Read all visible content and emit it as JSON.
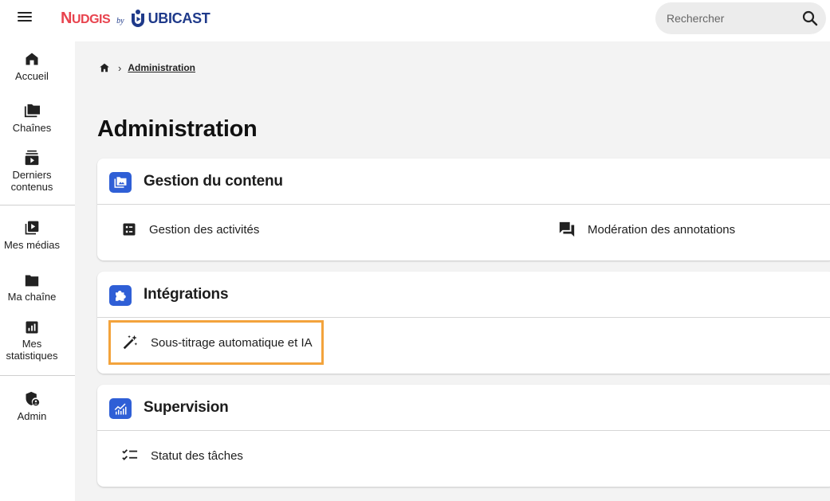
{
  "header": {
    "logo": {
      "brand_prefix": "N",
      "brand_rest": "UDGIS",
      "by": "by",
      "company": "UBICAST"
    },
    "search": {
      "placeholder": "Rechercher"
    }
  },
  "sidebar": {
    "items": [
      {
        "label": "Accueil",
        "icon": "home-icon"
      },
      {
        "label": "Chaînes",
        "icon": "folders-icon"
      },
      {
        "label": "Derniers contenus",
        "icon": "subscriptions-icon"
      },
      {
        "label": "Mes médias",
        "icon": "video-library-icon"
      },
      {
        "label": "Ma chaîne",
        "icon": "folder-icon"
      },
      {
        "label": "Mes statistiques",
        "icon": "analytics-icon"
      },
      {
        "label": "Admin",
        "icon": "admin-shield-icon"
      }
    ]
  },
  "breadcrumb": {
    "current": "Administration"
  },
  "page_title": "Administration",
  "sections": [
    {
      "title": "Gestion du contenu",
      "icon": "perm-media-icon",
      "links": [
        {
          "label": "Gestion des activités",
          "icon": "list-alt-icon"
        },
        {
          "label": "Modération des annotations",
          "icon": "forum-icon"
        }
      ]
    },
    {
      "title": "Intégrations",
      "icon": "extension-icon",
      "links": [
        {
          "label": "Sous-titrage automatique et IA",
          "icon": "auto-fix-icon"
        }
      ]
    },
    {
      "title": "Supervision",
      "icon": "monitoring-icon",
      "links": [
        {
          "label": "Statut des tâches",
          "icon": "checklist-icon"
        }
      ]
    }
  ],
  "colors": {
    "accent": "#2f5fd6",
    "brand_red": "#e8434e",
    "brand_blue": "#1f3a8a",
    "highlight": "#f3a33c",
    "content_bg": "#f3f3f3"
  }
}
